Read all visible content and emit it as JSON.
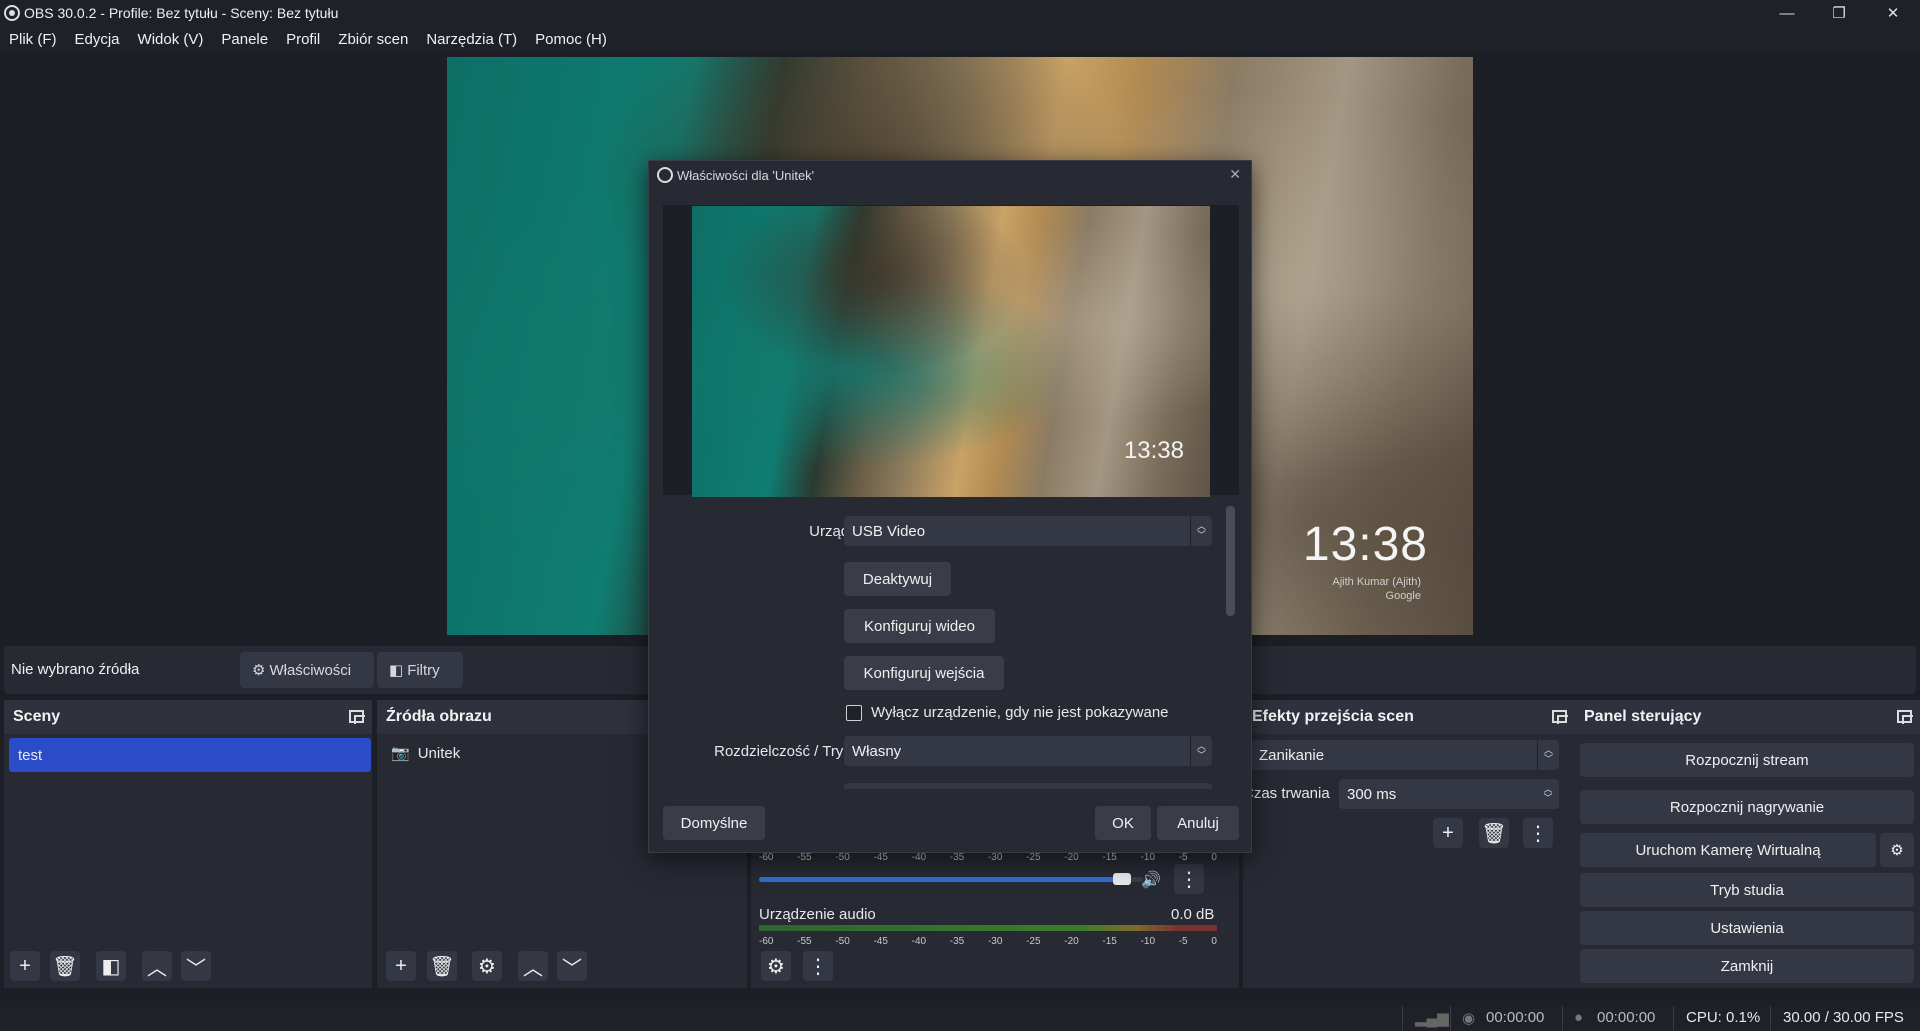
{
  "window": {
    "title": "OBS 30.0.2 - Profile: Bez tytułu - Sceny: Bez tytułu",
    "minimize": "—",
    "maximize": "❐",
    "close": "✕"
  },
  "menu": [
    "Plik (F)",
    "Edycja",
    "Widok (V)",
    "Panele",
    "Profil",
    "Zbiór scen",
    "Narzędzia (T)",
    "Pomoc (H)"
  ],
  "preview": {
    "clock": "13:38",
    "credit_name": "Ajith Kumar (Ajith)",
    "credit_source": "Google"
  },
  "context_bar": {
    "no_source": "Nie wybrano źródła",
    "properties": "Właściwości",
    "filters": "Filtry"
  },
  "scenes": {
    "title": "Sceny",
    "items": [
      "test"
    ]
  },
  "sources": {
    "title": "Źródła obrazu",
    "items": [
      "Unitek"
    ]
  },
  "mixer": {
    "scale": [
      "-60",
      "-55",
      "-50",
      "-45",
      "-40",
      "-35",
      "-30",
      "-25",
      "-20",
      "-15",
      "-10",
      "-5",
      "0"
    ],
    "channel_name": "Urządzenie audio",
    "channel_level": "0.0 dB",
    "volume_fraction": 0.97
  },
  "transitions": {
    "title": "Efekty przejścia scen",
    "selected": "Zanikanie",
    "duration_label": "Czas trwania",
    "duration_value": "300 ms"
  },
  "controls": {
    "title": "Panel sterujący",
    "start_stream": "Rozpocznij stream",
    "start_recording": "Rozpocznij nagrywanie",
    "virtual_camera": "Uruchom Kamerę Wirtualną",
    "studio_mode": "Tryb studia",
    "settings": "Ustawienia",
    "exit": "Zamknij"
  },
  "status": {
    "stream_time": "00:00:00",
    "record_time": "00:00:00",
    "cpu": "CPU: 0.1%",
    "fps": "30.00 / 30.00 FPS"
  },
  "dialog": {
    "title": "Właściwości dla 'Unitek'",
    "device_label": "Urządzenie",
    "device_value": "USB Video",
    "deactivate": "Deaktywuj",
    "configure_video": "Konfiguruj wideo",
    "configure_input": "Konfiguruj wejścia",
    "disable_when_hidden": "Wyłącz urządzenie, gdy nie jest pokazywane",
    "resolution_fps_label": "Rozdzielczość / Tryb FPS",
    "resolution_fps_value": "Własny",
    "defaults": "Domyślne",
    "ok": "OK",
    "cancel": "Anuluj",
    "preview_clock": "13:38"
  },
  "colors": {
    "selected_scene": "#2a4cc9",
    "panel_bg": "#272a33",
    "window_bg": "#1d1f26"
  }
}
